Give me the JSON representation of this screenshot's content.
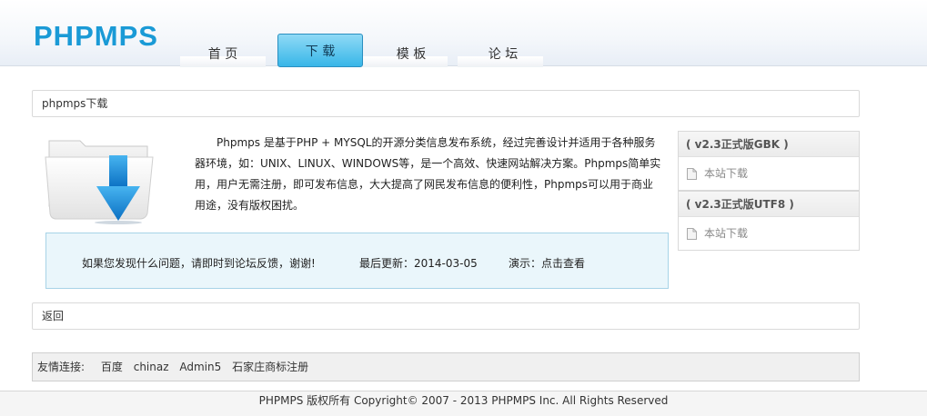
{
  "header": {
    "logo": "PHPMPS",
    "nav": [
      {
        "label": "首 页",
        "active": false
      },
      {
        "label": "下 载",
        "active": true
      },
      {
        "label": "模 板",
        "active": false
      },
      {
        "label": "论 坛",
        "active": false
      }
    ]
  },
  "main": {
    "title": "phpmps下载",
    "description": "Phpmps 是基于PHP + MYSQL的开源分类信息发布系统，经过完善设计并适用于各种服务器环境，如：UNIX、LINUX、WINDOWS等，是一个高效、快速网站解决方案。Phpmps简单实用，用户无需注册，即可发布信息，大大提高了网民发布信息的便利性，Phpmps可以用于商业用途，没有版权困扰。",
    "info": {
      "feedback": "如果您发现什么问题，请即时到论坛反馈，谢谢!",
      "updated": "最后更新：2014-03-05",
      "demo": "演示：点击查看"
    },
    "downloads": [
      {
        "title": "( v2.3正式版GBK )",
        "link": "本站下载"
      },
      {
        "title": "( v2.3正式版UTF8 )",
        "link": "本站下载"
      }
    ],
    "back": "返回"
  },
  "friend_links": {
    "label": "友情连接:",
    "items": [
      "百度",
      "chinaz",
      "Admin5",
      "石家庄商标注册"
    ]
  },
  "footer": {
    "copyright": "PHPMPS 版权所有 Copyright© 2007 - 2013 PHPMPS Inc. All Rights Reserved"
  },
  "colors": {
    "brand": "#1a9ad6",
    "active_tab": "#38b6e8",
    "info_bg": "#eaf6fb"
  }
}
